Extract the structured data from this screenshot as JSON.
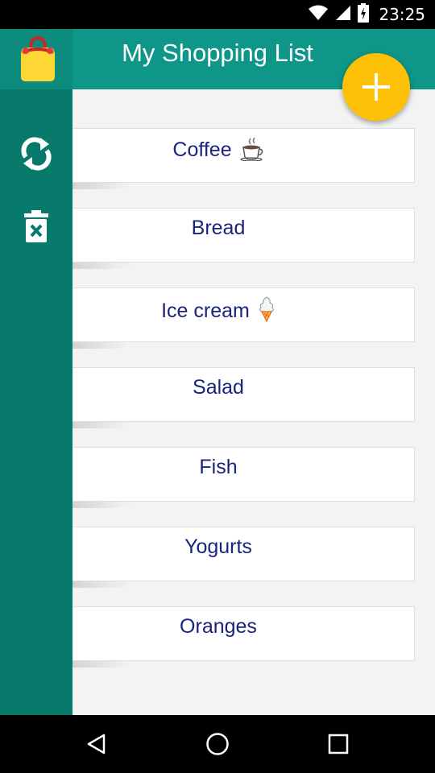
{
  "status_bar": {
    "time": "23:25"
  },
  "app": {
    "title": "My Shopping List",
    "items": [
      {
        "label": "Coffee",
        "emoji": "coffee-cup-icon"
      },
      {
        "label": "Bread"
      },
      {
        "label": "Ice cream",
        "emoji": "ice-cream-icon"
      },
      {
        "label": "Salad"
      },
      {
        "label": "Fish"
      },
      {
        "label": "Yogurts"
      },
      {
        "label": "Oranges"
      }
    ]
  },
  "colors": {
    "header": "#0e9688",
    "sidebar": "#087a6c",
    "fab": "#ffc107",
    "item_text": "#1a237e"
  }
}
